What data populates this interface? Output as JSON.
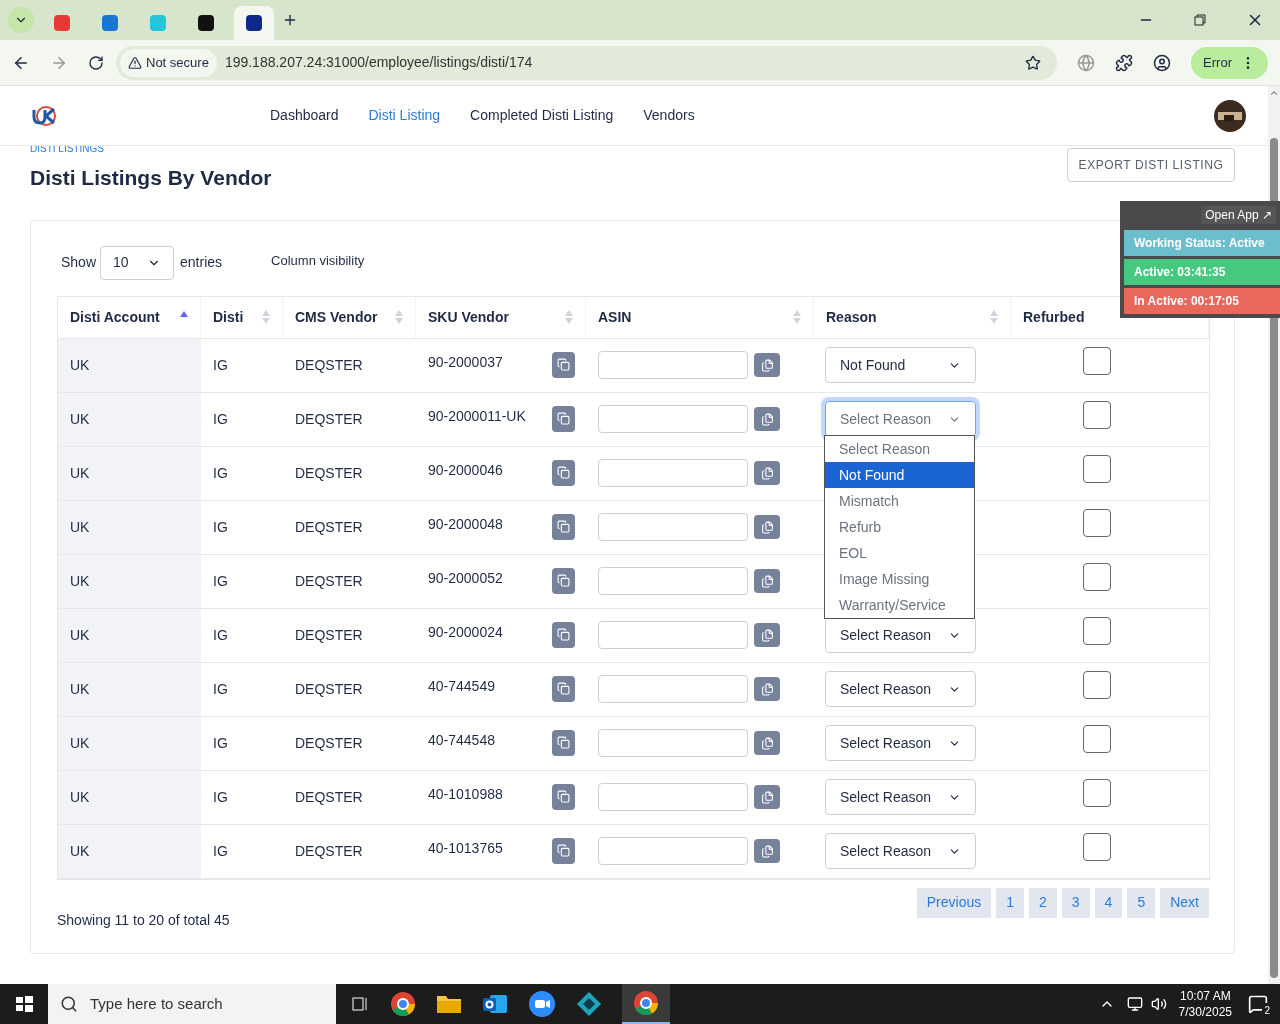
{
  "browser": {
    "tabs": [
      {
        "kind": "red",
        "selected": false
      },
      {
        "kind": "blue",
        "selected": false
      },
      {
        "kind": "cyan",
        "selected": false
      },
      {
        "kind": "dark",
        "selected": false
      },
      {
        "kind": "navy",
        "selected": true
      }
    ],
    "security": "Not secure",
    "url": "199.188.207.24:31000/employee/listings/disti/174",
    "profile_status": "Error"
  },
  "nav": {
    "items": [
      {
        "label": "Dashboard",
        "selected": false
      },
      {
        "label": "Disti Listing",
        "selected": true
      },
      {
        "label": "Completed Disti Listing",
        "selected": false
      },
      {
        "label": "Vendors",
        "selected": false
      }
    ]
  },
  "breadcrumb": "DISTI LISTINGS",
  "title": "Disti Listings By Vendor",
  "export_button": "EXPORT DISTI LISTING",
  "widget": {
    "open_app": "Open App ↗",
    "status": "Working Status: Active",
    "active": "Active: 03:41:35",
    "inactive": "In Active: 00:17:05"
  },
  "controls": {
    "show": "Show",
    "entries_value": "10",
    "entries": "entries",
    "column_visibility": "Column visibility"
  },
  "table": {
    "columns": [
      {
        "label": "Disti Account",
        "sorted": true
      },
      {
        "label": "Disti",
        "sorted": false
      },
      {
        "label": "CMS Vendor",
        "sorted": false
      },
      {
        "label": "SKU Vendor",
        "sorted": false
      },
      {
        "label": "ASIN",
        "sorted": false
      },
      {
        "label": "Reason",
        "sorted": false
      },
      {
        "label": "Refurbed"
      }
    ],
    "rows": [
      {
        "account": "UK",
        "disti": "IG",
        "vendor": "DEQSTER",
        "sku": "90-2000037",
        "reason": "Not Found",
        "focused": false,
        "refurbed": false
      },
      {
        "account": "UK",
        "disti": "IG",
        "vendor": "DEQSTER",
        "sku": "90-2000011-UK",
        "reason": "Select Reason",
        "focused": true,
        "refurbed": false
      },
      {
        "account": "UK",
        "disti": "IG",
        "vendor": "DEQSTER",
        "sku": "90-2000046",
        "refurbed": false
      },
      {
        "account": "UK",
        "disti": "IG",
        "vendor": "DEQSTER",
        "sku": "90-2000048",
        "refurbed": false
      },
      {
        "account": "UK",
        "disti": "IG",
        "vendor": "DEQSTER",
        "sku": "90-2000052",
        "refurbed": false
      },
      {
        "account": "UK",
        "disti": "IG",
        "vendor": "DEQSTER",
        "sku": "90-2000024",
        "reason": "Select Reason",
        "focused": false,
        "refurbed": false
      },
      {
        "account": "UK",
        "disti": "IG",
        "vendor": "DEQSTER",
        "sku": "40-744549",
        "reason": "Select Reason",
        "focused": false,
        "refurbed": false
      },
      {
        "account": "UK",
        "disti": "IG",
        "vendor": "DEQSTER",
        "sku": "40-744548",
        "reason": "Select Reason",
        "focused": false,
        "refurbed": false
      },
      {
        "account": "UK",
        "disti": "IG",
        "vendor": "DEQSTER",
        "sku": "40-1010988",
        "reason": "Select Reason",
        "focused": false,
        "refurbed": false
      },
      {
        "account": "UK",
        "disti": "IG",
        "vendor": "DEQSTER",
        "sku": "40-1013765",
        "reason": "Select Reason",
        "focused": false,
        "refurbed": false
      }
    ]
  },
  "dropdown": {
    "options": [
      {
        "label": "Select Reason",
        "selected": false
      },
      {
        "label": "Not Found",
        "selected": true
      },
      {
        "label": "Mismatch",
        "selected": false
      },
      {
        "label": "Refurb",
        "selected": false
      },
      {
        "label": "EOL",
        "selected": false
      },
      {
        "label": "Image Missing",
        "selected": false
      },
      {
        "label": "Warranty/Service",
        "selected": false
      }
    ]
  },
  "footer": {
    "info": "Showing 11 to 20 of total 45",
    "pagination": [
      "Previous",
      "1",
      "2",
      "3",
      "4",
      "5",
      "Next"
    ]
  },
  "taskbar": {
    "search_placeholder": "Type here to search",
    "time": "10:07 AM",
    "date": "7/30/2025",
    "notifications": "2"
  }
}
